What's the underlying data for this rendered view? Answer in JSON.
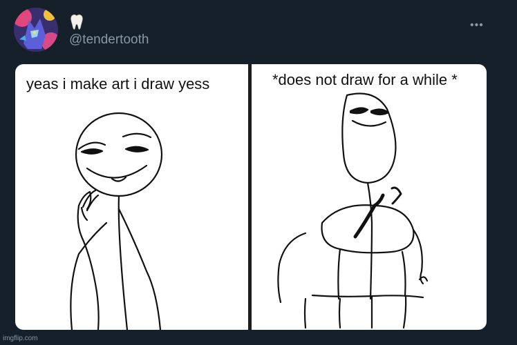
{
  "tweet": {
    "handle": "@tendertooth",
    "name_emoji": "tooth-icon",
    "more_label": "•••"
  },
  "comic": {
    "left_caption": "yeas i make art i draw yess",
    "right_caption": "*does not draw for a while *"
  },
  "watermark": "imgflip.com",
  "colors": {
    "background": "#15202b",
    "handle_text": "#8b98a5",
    "panel": "#ffffff",
    "ink": "#111111"
  }
}
